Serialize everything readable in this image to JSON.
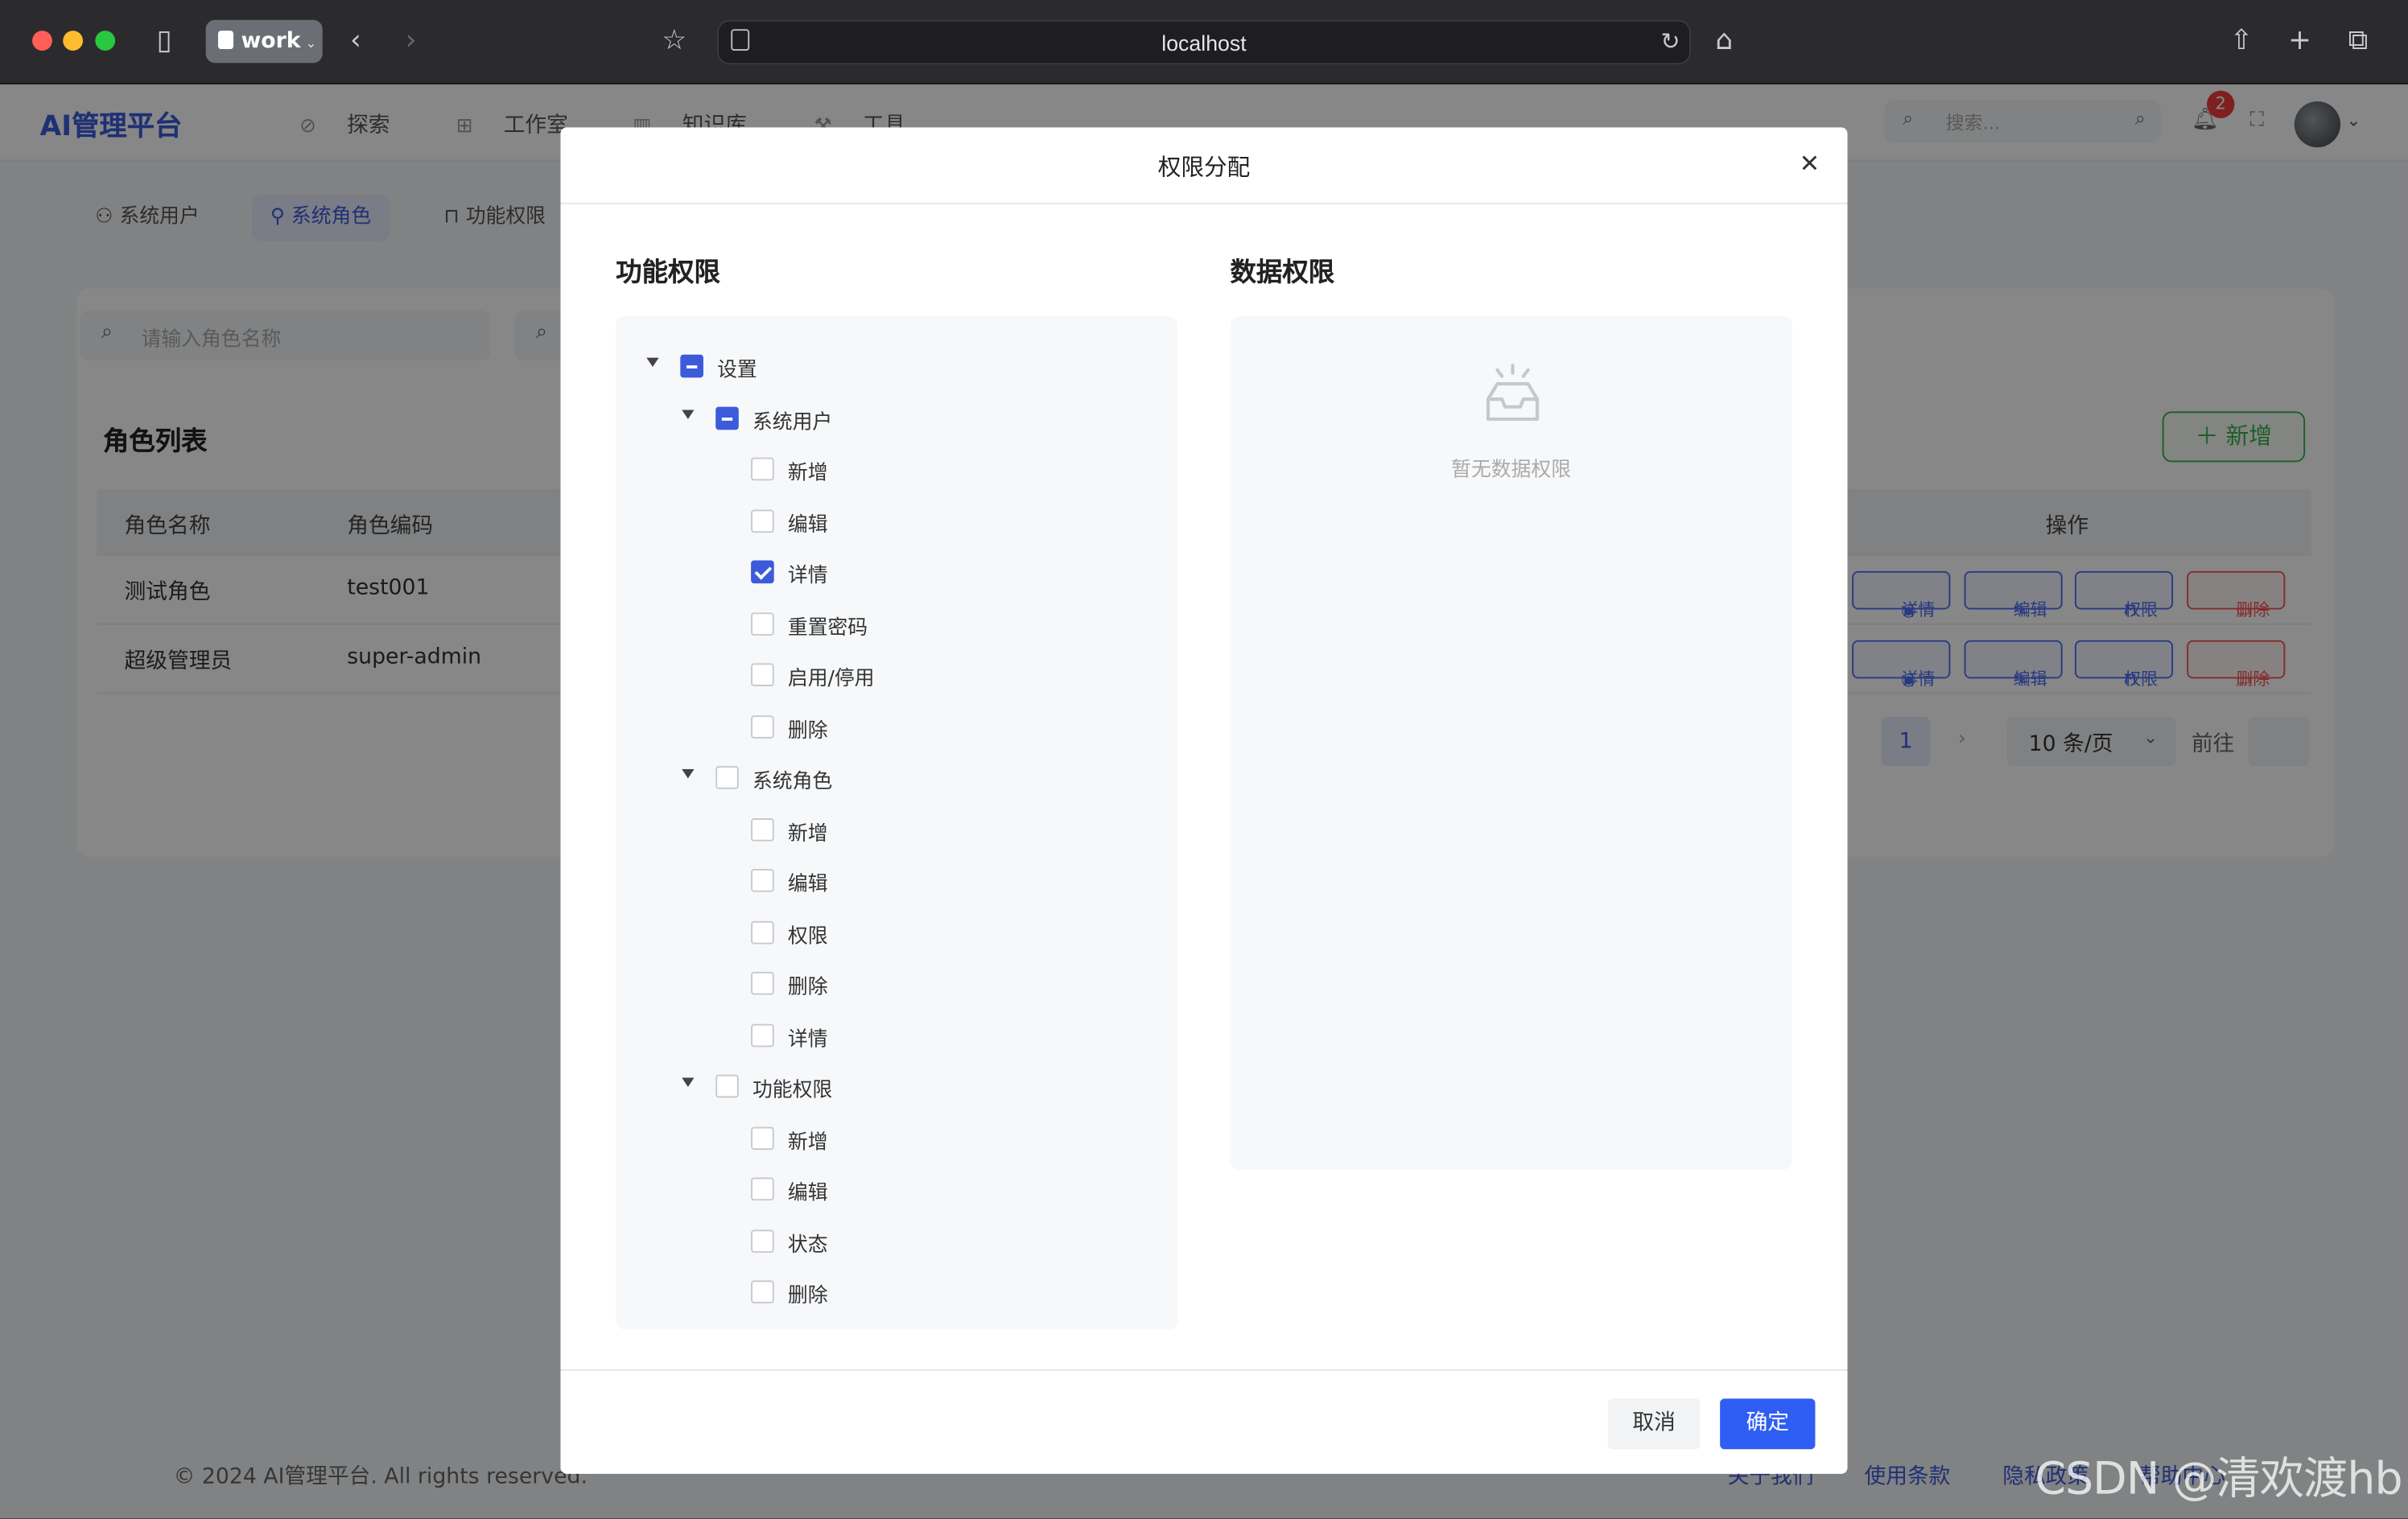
{
  "browser": {
    "profile": "work",
    "url": "localhost"
  },
  "app": {
    "brand": "AI管理平台",
    "nav": [
      "探索",
      "工作室",
      "知识库",
      "工具"
    ],
    "search_placeholder": "搜索...",
    "notification_count": "2"
  },
  "subtabs": [
    "系统用户",
    "系统角色",
    "功能权限"
  ],
  "roles_page": {
    "filter_placeholder": "请输入角色名称",
    "list_title": "角色列表",
    "add_button": "新增",
    "columns": {
      "name": "角色名称",
      "code": "角色编码",
      "actions": "操作"
    },
    "rows": [
      {
        "name": "测试角色",
        "code": "test001"
      },
      {
        "name": "超级管理员",
        "code": "super-admin"
      }
    ],
    "row_actions": {
      "detail": "详情",
      "edit": "编辑",
      "perm": "权限",
      "delete": "删除"
    },
    "pagination": {
      "current": "1",
      "page_size": "10 条/页",
      "goto": "前往"
    }
  },
  "footer": {
    "copyright": "© 2024 AI管理平台. All rights reserved.",
    "links": [
      "关于我们",
      "使用条款",
      "隐私政策",
      "帮助中心"
    ]
  },
  "modal": {
    "title": "权限分配",
    "func_title": "功能权限",
    "data_title": "数据权限",
    "data_empty": "暂无数据权限",
    "tree": {
      "root": {
        "label": "设置",
        "state": "indeterminate"
      },
      "groups": [
        {
          "label": "系统用户",
          "state": "indeterminate",
          "children": [
            {
              "label": "新增",
              "checked": false
            },
            {
              "label": "编辑",
              "checked": false
            },
            {
              "label": "详情",
              "checked": true
            },
            {
              "label": "重置密码",
              "checked": false
            },
            {
              "label": "启用/停用",
              "checked": false
            },
            {
              "label": "删除",
              "checked": false
            }
          ]
        },
        {
          "label": "系统角色",
          "state": "unchecked",
          "children": [
            {
              "label": "新增",
              "checked": false
            },
            {
              "label": "编辑",
              "checked": false
            },
            {
              "label": "权限",
              "checked": false
            },
            {
              "label": "删除",
              "checked": false
            },
            {
              "label": "详情",
              "checked": false
            }
          ]
        },
        {
          "label": "功能权限",
          "state": "unchecked",
          "children": [
            {
              "label": "新增",
              "checked": false
            },
            {
              "label": "编辑",
              "checked": false
            },
            {
              "label": "状态",
              "checked": false
            },
            {
              "label": "删除",
              "checked": false
            }
          ]
        }
      ]
    },
    "cancel": "取消",
    "confirm": "确定"
  },
  "watermark": "CSDN @清欢渡hb",
  "colors": {
    "primary": "#2f5ef5",
    "success": "#37b24d",
    "danger": "#fa5252"
  }
}
